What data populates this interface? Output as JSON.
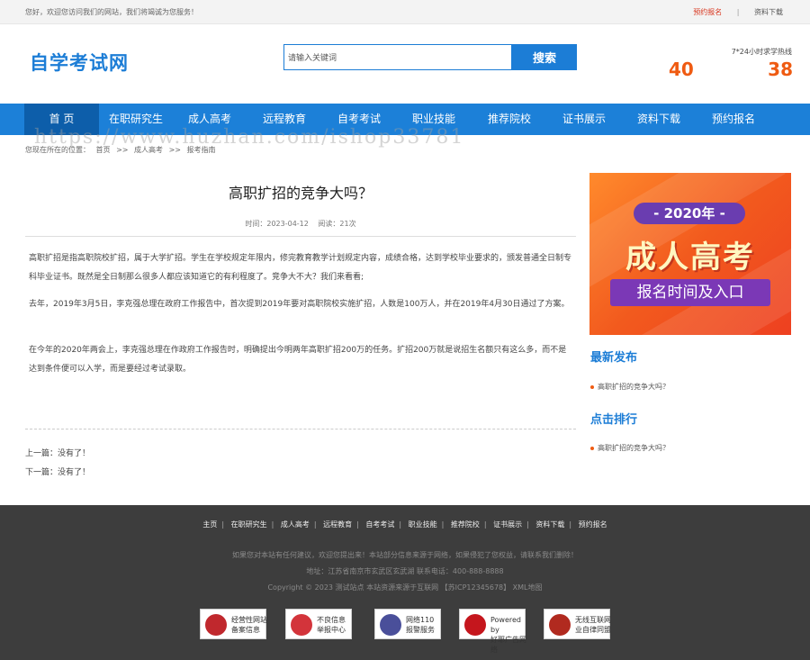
{
  "topbar": {
    "welcome": "您好，欢迎您访问我们的网站，我们将竭诚为您服务！",
    "register": "预约报名",
    "separator": "|",
    "download": "资料下载"
  },
  "header": {
    "logo": "自学考试网",
    "search_placeholder": "请输入关键词",
    "search_button": "搜索",
    "hotline_label": "7*24小时求学热线",
    "hotline_left": "40",
    "hotline_right": "38"
  },
  "nav": {
    "items": [
      {
        "label": "首 页"
      },
      {
        "label": "在职研究生"
      },
      {
        "label": "成人高考"
      },
      {
        "label": "远程教育"
      },
      {
        "label": "自考考试"
      },
      {
        "label": "职业技能"
      },
      {
        "label": "推荐院校"
      },
      {
        "label": "证书展示"
      },
      {
        "label": "资料下载"
      },
      {
        "label": "预约报名"
      }
    ]
  },
  "watermark": "https://www.huzhan.com/ishop33781",
  "breadcrumb": {
    "prefix": "您现在所在的位置：",
    "home": "首页",
    "sep1": ">>",
    "category": "成人高考",
    "sep2": ">>",
    "current": "报考指南"
  },
  "article": {
    "title": "高职扩招的竞争大吗？",
    "time": "时间：2023-04-12",
    "views": "阅读：21次",
    "paragraphs": [
      "高职扩招是指高职院校扩招，属于大学扩招。学生在学校规定年限内，修完教育教学计划规定内容，成绩合格，达到学校毕业要求的，颁发普通全日制专科毕业证书。既然是全日制那么很多人都应该知道它的有利程度了。竞争大不大？我们来看看;",
      "去年，2019年3月5日，李克强总理在政府工作报告中，首次提到2019年要对高职院校实施扩招，人数是100万人，并在2019年4月30日通过了方案。",
      "在今年的2020年两会上，李克强总理在作政府工作报告时，明确提出今明两年高职扩招200万的任务。扩招200万就是说招生名额只有这么多，而不是达到条件便可以入学，而是要经过考试录取。"
    ],
    "prev": "上一篇：没有了！",
    "next": "下一篇：没有了！"
  },
  "banner": {
    "year": "- 2020年 -",
    "main": "成人高考",
    "sub": "报名时间及入口"
  },
  "sidebar": {
    "latest_title": "最新发布",
    "latest_items": [
      "高职扩招的竞争大吗？"
    ],
    "hot_title": "点击排行",
    "hot_items": [
      "高职扩招的竞争大吗？"
    ]
  },
  "footer": {
    "nav": [
      "主页",
      "在职研究生",
      "成人高考",
      "远程教育",
      "自考考试",
      "职业技能",
      "推荐院校",
      "证书展示",
      "资料下载",
      "预约报名"
    ],
    "notice": "如果您对本站有任何建议，欢迎您提出来！本站部分信息来源于网络，如果侵犯了您权益，请联系我们删除！",
    "address": "地址：江苏省南京市玄武区玄武湖   联系电话：400-888-8888",
    "copyright": "Copyright © 2023 测试站点 本站资源来源于互联网 【苏ICP12345678】 XML地图",
    "badges": [
      {
        "line1": "经营性网站",
        "line2": "备案信息",
        "color": "#c0282d",
        "icon": "police-badge-icon"
      },
      {
        "line1": "不良信息",
        "line2": "举报中心",
        "color": "#d3343b",
        "icon": "report-center-icon"
      },
      {
        "line1": "网络110",
        "line2": "报警服务",
        "color": "#4a4f9a",
        "icon": "police-shield-icon"
      },
      {
        "line1": "Powered by",
        "line2": "好耶广告网络",
        "color": "#c5161d",
        "icon": "allyes-logo-icon"
      },
      {
        "line1": "无线互联网",
        "line2": "业自律同盟",
        "color": "#b12a1f",
        "icon": "alliance-seal-icon"
      }
    ]
  }
}
